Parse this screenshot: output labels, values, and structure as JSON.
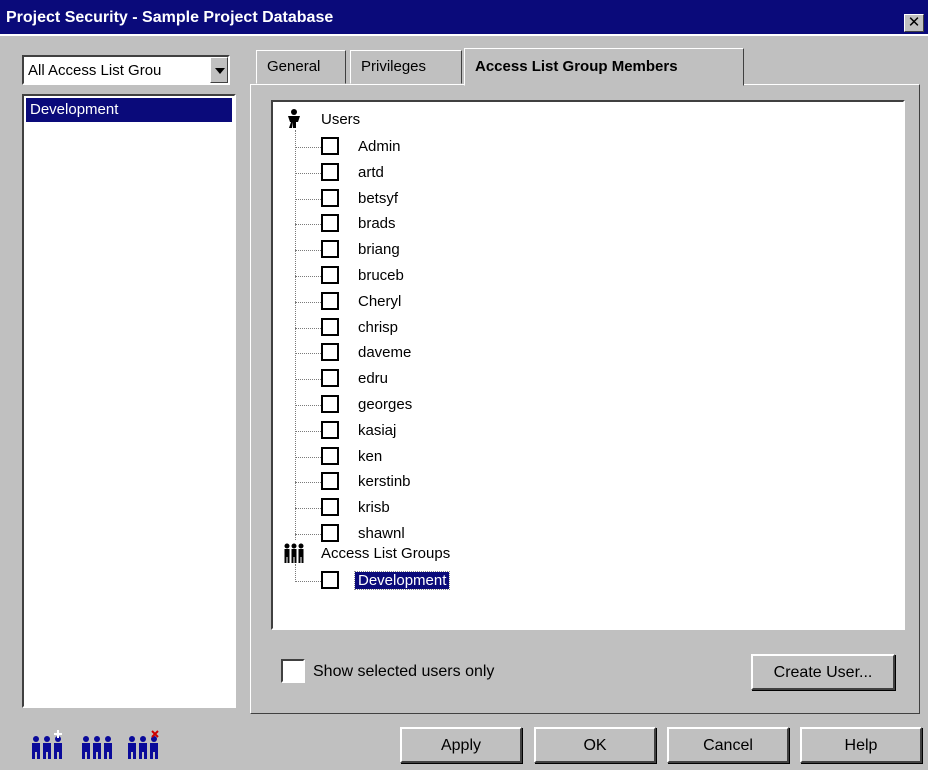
{
  "window": {
    "title": "Project Security - Sample Project Database",
    "close_glyph": "✕"
  },
  "left_pane": {
    "filter_value": "All Access List Grou",
    "groups": [
      "Development"
    ]
  },
  "tabs": [
    {
      "label": "General",
      "active": false
    },
    {
      "label": "Privileges",
      "active": false
    },
    {
      "label": "Access List Group Members",
      "active": true
    }
  ],
  "tree": {
    "users_heading": "Users",
    "users_icon": "person-icon",
    "users": [
      "Admin",
      "artd",
      "betsyf",
      "brads",
      "briang",
      "bruceb",
      "Cheryl",
      "chrisp",
      "daveme",
      "edru",
      "georges",
      "kasiaj",
      "ken",
      "kerstinb",
      "krisb",
      "shawnl"
    ],
    "groups_heading": "Access List Groups",
    "groups_icon": "group-icon",
    "groups": [
      "Development"
    ],
    "selected_group": "Development"
  },
  "options": {
    "show_selected_label": "Show selected users only",
    "show_selected_checked": false
  },
  "buttons": {
    "create_user": "Create User...",
    "apply": "Apply",
    "ok": "OK",
    "cancel": "Cancel",
    "help": "Help"
  },
  "footer_icons": [
    "add-group-icon",
    "edit-group-icon",
    "delete-group-icon"
  ],
  "colors": {
    "selection": "#0a0a7a",
    "face": "#c0c0c0",
    "add_mark": "#ffffff",
    "delete_mark": "#cc0000"
  }
}
